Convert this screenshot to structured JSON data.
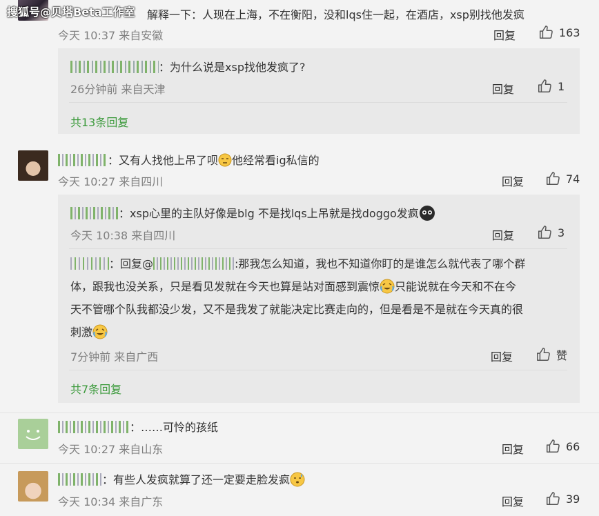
{
  "watermark": "搜狐号@贝塔Beta工作室",
  "comments": [
    {
      "text": "解释一下：人现在上海，不在衡阳，没和lqs住一起，在酒店，xsp别找他发疯",
      "time": "今天 10:37 来自安徽",
      "reply": "回复",
      "likes": "163",
      "sub": [
        {
          "sep": "：",
          "text": "为什么说是xsp找他发疯了?",
          "time": "26分钟前 来自天津",
          "reply": "回复",
          "likes": "1"
        }
      ],
      "more": "共13条回复"
    },
    {
      "sep": "：",
      "text_a": "又有人找他上吊了呗",
      "text_b": "他经常看ig私信的",
      "time": "今天 10:27 来自四川",
      "reply": "回复",
      "likes": "74",
      "sub": [
        {
          "sep": "：",
          "text": "xsp心里的主队好像是blg 不是找lqs上吊就是找doggo发疯",
          "time": "今天 10:38 来自四川",
          "reply": "回复",
          "likes": "3"
        },
        {
          "sep": "：",
          "prefix": "回复@",
          "line1": ":那我怎么知道，我也不知道你盯的是谁怎么就代表了哪个群",
          "line2": "体，跟我也没关系，只是看见发就在今天也算是站对面感到震惊",
          "line2b": "只能说就在今天和不在今",
          "line3": "天不管哪个队我都没少发，又不是我发了就能决定比赛走向的，但是看是不是就在今天真的很",
          "line4": "刺激",
          "time": "7分钟前 来自广西",
          "reply": "回复",
          "likes": "赞"
        }
      ],
      "more": "共7条回复"
    },
    {
      "sep": "：",
      "text": "……可怜的孩纸",
      "time": "今天 10:27 来自山东",
      "reply": "回复",
      "likes": "66"
    },
    {
      "sep": "：",
      "text": "有些人发疯就算了还一定要走脸发疯",
      "time": "今天 10:34 来自广东",
      "reply": "回复",
      "likes": "39"
    }
  ],
  "icons": {
    "like": "thumbs-up-icon"
  },
  "colors": {
    "more_link": "#3c9a3c",
    "meta": "#808080",
    "sub_bg": "#e9e9e9"
  }
}
